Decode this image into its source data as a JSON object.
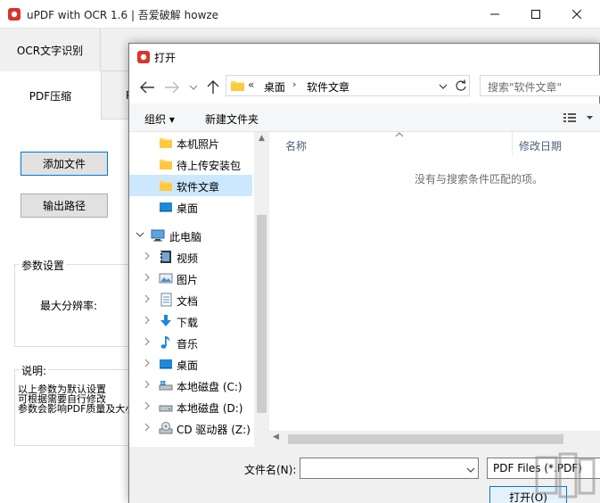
{
  "app": {
    "title": "uPDF with OCR 1.6 |  吾爱破解 howze",
    "tabs": {
      "ocr": "OCR文字识别",
      "pdf_compress": "PDF压缩",
      "extra": "P"
    },
    "buttons": {
      "add_file": "添加文件",
      "output_path": "输出路径"
    },
    "params_group": {
      "label": "参数设置",
      "max_resolution": "最大分辨率:"
    },
    "info_group": {
      "label": "说明:",
      "lines": [
        "以上参数为默认设置",
        "可根据需要自行修改",
        "参数会影响PDF质量及大小"
      ]
    }
  },
  "dialog": {
    "title": "打开",
    "address": {
      "overflow": "«",
      "segments": [
        "桌面",
        "软件文章"
      ],
      "separator": "›"
    },
    "search_placeholder": "搜索\"软件文章\"",
    "toolbar": {
      "organize": "组织 ▾",
      "new_folder": "新建文件夹"
    },
    "nav_items": [
      {
        "label": "本机照片",
        "icon": "folder-icon",
        "selected": false
      },
      {
        "label": "待上传安装包",
        "icon": "folder-icon",
        "selected": false
      },
      {
        "label": "软件文章",
        "icon": "folder-icon",
        "selected": true
      },
      {
        "label": "桌面",
        "icon": "desktop-icon",
        "selected": false
      },
      {
        "label": "此电脑",
        "icon": "computer-icon",
        "expanded": true
      },
      {
        "label": "视频",
        "icon": "video-icon"
      },
      {
        "label": "图片",
        "icon": "pictures-icon"
      },
      {
        "label": "文档",
        "icon": "documents-icon"
      },
      {
        "label": "下载",
        "icon": "download-icon"
      },
      {
        "label": "音乐",
        "icon": "music-icon"
      },
      {
        "label": "桌面",
        "icon": "desktop-icon"
      },
      {
        "label": "本地磁盘 (C:)",
        "icon": "drive-windows-icon"
      },
      {
        "label": "本地磁盘 (D:)",
        "icon": "drive-icon"
      },
      {
        "label": "CD 驱动器 (Z:)",
        "icon": "cd-drive-icon"
      }
    ],
    "columns": {
      "name": "名称",
      "date": "修改日期"
    },
    "empty_message": "没有与搜索条件匹配的项。",
    "footer": {
      "filename_label": "文件名(N):",
      "filename_value": "",
      "filetype": "PDF Files (*.PDF)",
      "open_button": "打开(O)"
    }
  },
  "colors": {
    "selection": "#cce8ff",
    "accent": "#0078d7",
    "folder": "#ffd766"
  }
}
